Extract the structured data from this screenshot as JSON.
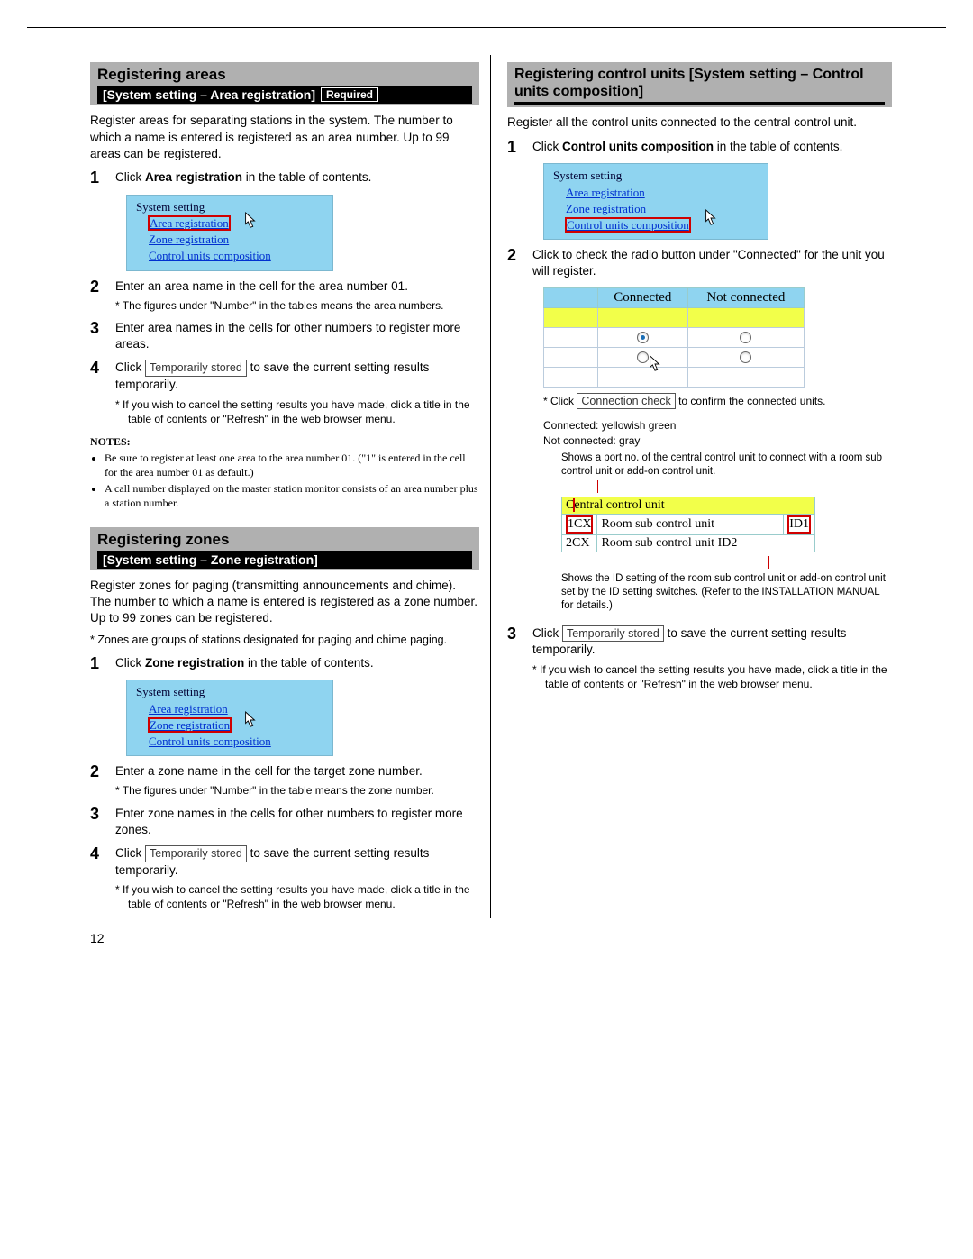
{
  "page_number": "12",
  "areas": {
    "title": "Registering areas",
    "subtitle": "[System setting – Area registration]",
    "required": "Required",
    "intro": "Register areas for separating stations in the system. The number to which a name is entered is registered as an area number. Up to 99 areas can be registered.",
    "steps": [
      {
        "n": "1",
        "pre": "Click ",
        "bold": "Area registration",
        "post": " in the table of contents."
      },
      {
        "n": "2",
        "text": "Enter an area name in the cell for the area number 01.",
        "sub": "The figures under \"Number\" in the tables means the area numbers."
      },
      {
        "n": "3",
        "text": "Enter area names in the cells for other numbers to register more areas."
      },
      {
        "n": "4",
        "pre": "Click ",
        "btn": "Temporarily stored",
        "post": " to save the current setting results temporarily.",
        "sub": "If you wish to cancel the setting results you have made, click a title in the table of contents or \"Refresh\" in the web browser menu."
      }
    ],
    "notes_label": "NOTES:",
    "notes": [
      "Be sure to register at least one area to the area number 01. (\"1\" is entered in the cell for the area number 01 as default.)",
      "A call number displayed on the master station monitor consists of an area number plus a station number."
    ]
  },
  "zones": {
    "title": "Registering zones",
    "subtitle": "[System setting – Zone registration]",
    "intro": "Register zones for paging (transmitting announcements and chime). The number to which a name is entered is registered as a zone number. Up to 99 zones can be registered.",
    "footnote": "* Zones are groups of stations designated for paging and chime paging.",
    "steps": [
      {
        "n": "1",
        "pre": "Click ",
        "bold": "Zone registration",
        "post": " in the table of contents."
      },
      {
        "n": "2",
        "text": "Enter a zone name in the cell for the target zone number.",
        "sub": "The figures under \"Number\" in the table means the zone number."
      },
      {
        "n": "3",
        "text": "Enter zone names in the cells for other numbers to register more zones."
      },
      {
        "n": "4",
        "pre": "Click ",
        "btn": "Temporarily stored",
        "post": " to save the current setting results temporarily.",
        "sub": "If you wish to cancel the setting results you have made, click a title in the table of contents or \"Refresh\" in the web browser menu."
      }
    ]
  },
  "ctrl": {
    "title": "Registering control units [System setting – Control units composition]",
    "intro": "Register all the control units connected to the central control unit.",
    "steps": [
      {
        "n": "1",
        "pre": "Click ",
        "bold": "Control units composition",
        "post": " in the table of contents."
      },
      {
        "n": "2",
        "text": "Click to check the radio button under \"Connected\" for the unit you will register."
      },
      {
        "n": "3",
        "pre": "Click ",
        "btn": "Temporarily stored",
        "post": " to save the current setting results temporarily.",
        "sub": "If you wish to cancel the setting results you have made, click a title in the table of contents or \"Refresh\" in the web browser menu."
      }
    ],
    "conn_check_pre": "Click ",
    "conn_check_btn": "Connection check",
    "conn_check_post": " to confirm the connected units.",
    "legend1": "Connected: yellowish green",
    "legend2": "Not connected: gray",
    "anno_top": "Shows a port no. of the central control unit to connect with a room sub control unit or add-on control unit.",
    "anno_bottom": "Shows the ID setting of the room sub control unit or add-on control unit set by the ID setting switches. (Refer to the INSTALLATION MANUAL for details.)"
  },
  "menu": {
    "header": "System setting",
    "area": "Area registration",
    "zone": "Zone registration",
    "ctrl": "Control units composition"
  },
  "conn_table": {
    "h1": "Connected",
    "h2": "Not connected"
  },
  "ctrl_table": {
    "r1": "Central control unit",
    "r2a": "1CX",
    "r2b": "Room sub control unit",
    "r2c": "ID1",
    "r3a": "2CX",
    "r3b": "Room sub control unit ID2"
  }
}
